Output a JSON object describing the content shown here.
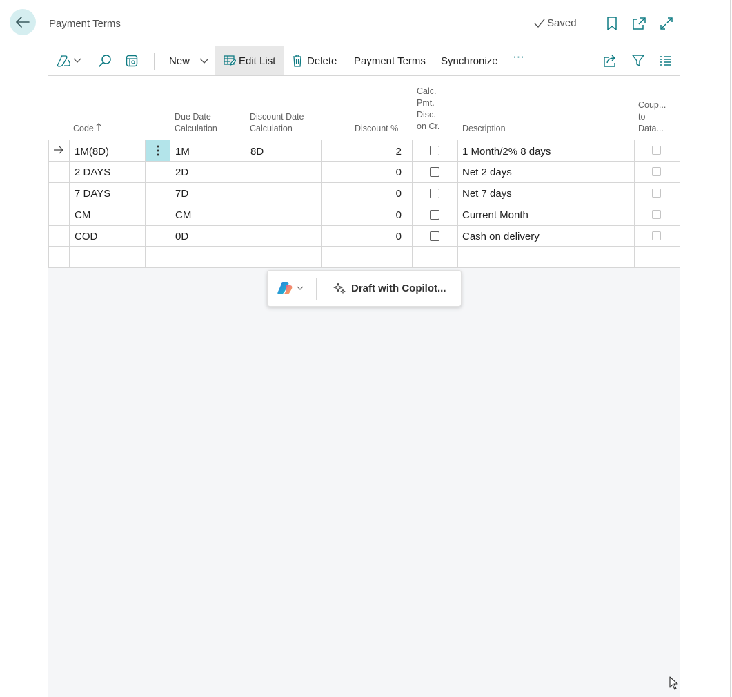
{
  "header": {
    "title": "Payment Terms",
    "saved_label": "Saved"
  },
  "actionbar": {
    "new_label": "New",
    "edit_list_label": "Edit List",
    "delete_label": "Delete",
    "payment_terms_label": "Payment Terms",
    "synchronize_label": "Synchronize",
    "more_label": "···"
  },
  "table": {
    "columns": {
      "code": "Code",
      "due_date_1": "Due Date",
      "due_date_2": "Calculation",
      "discount_date_1": "Discount Date",
      "discount_date_2": "Calculation",
      "discount_pct": "Discount %",
      "calc_1": "Calc.",
      "calc_2": "Pmt.",
      "calc_3": "Disc.",
      "calc_4": "on Cr.",
      "description": "Description",
      "coupled_1": "Coup...",
      "coupled_2": "to",
      "coupled_3": "Data..."
    },
    "rows": [
      {
        "code": "1M(8D)",
        "due": "1M",
        "disc_date": "8D",
        "disc_pct": "2",
        "desc": "1 Month/2% 8 days"
      },
      {
        "code": "2 DAYS",
        "due": "2D",
        "disc_date": "",
        "disc_pct": "0",
        "desc": "Net 2 days"
      },
      {
        "code": "7 DAYS",
        "due": "7D",
        "disc_date": "",
        "disc_pct": "0",
        "desc": "Net 7 days"
      },
      {
        "code": "CM",
        "due": "CM",
        "disc_date": "",
        "disc_pct": "0",
        "desc": "Current Month"
      },
      {
        "code": "COD",
        "due": "0D",
        "disc_date": "",
        "disc_pct": "0",
        "desc": "Cash on delivery"
      }
    ]
  },
  "copilot": {
    "draft_label": "Draft with Copilot..."
  },
  "colors": {
    "accent": "#0f7b83",
    "selected_cell": "#b3e4ea",
    "back_btn": "#d5eef0"
  }
}
